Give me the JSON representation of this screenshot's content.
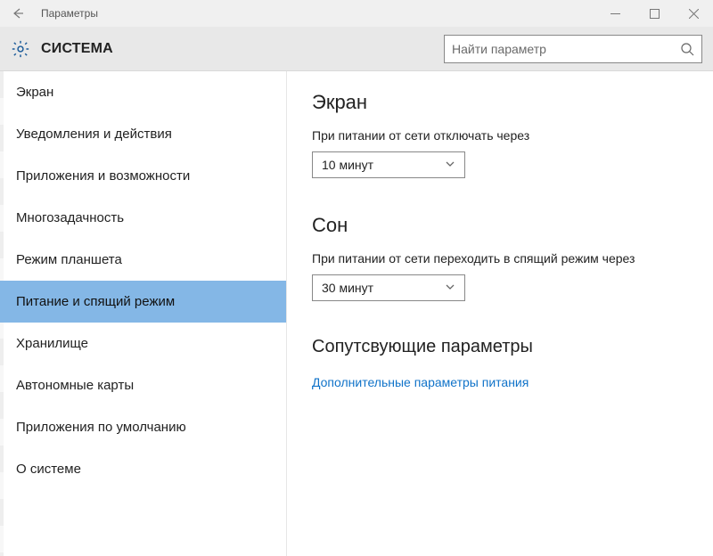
{
  "titlebar": {
    "title": "Параметры"
  },
  "header": {
    "section_title": "СИСТЕМА",
    "search_placeholder": "Найти параметр"
  },
  "sidebar": {
    "items": [
      {
        "label": "Экран",
        "active": false
      },
      {
        "label": "Уведомления и действия",
        "active": false
      },
      {
        "label": "Приложения и возможности",
        "active": false
      },
      {
        "label": "Многозадачность",
        "active": false
      },
      {
        "label": "Режим планшета",
        "active": false
      },
      {
        "label": "Питание и спящий режим",
        "active": true
      },
      {
        "label": "Хранилище",
        "active": false
      },
      {
        "label": "Автономные карты",
        "active": false
      },
      {
        "label": "Приложения по умолчанию",
        "active": false
      },
      {
        "label": "О системе",
        "active": false
      }
    ]
  },
  "content": {
    "screen": {
      "heading": "Экран",
      "label": "При питании от сети отключать через",
      "select_value": "10 минут"
    },
    "sleep": {
      "heading": "Сон",
      "label": "При питании от сети переходить в спящий режим через",
      "select_value": "30 минут"
    },
    "related": {
      "heading": "Сопутсвующие параметры",
      "link": "Дополнительные параметры питания"
    }
  }
}
